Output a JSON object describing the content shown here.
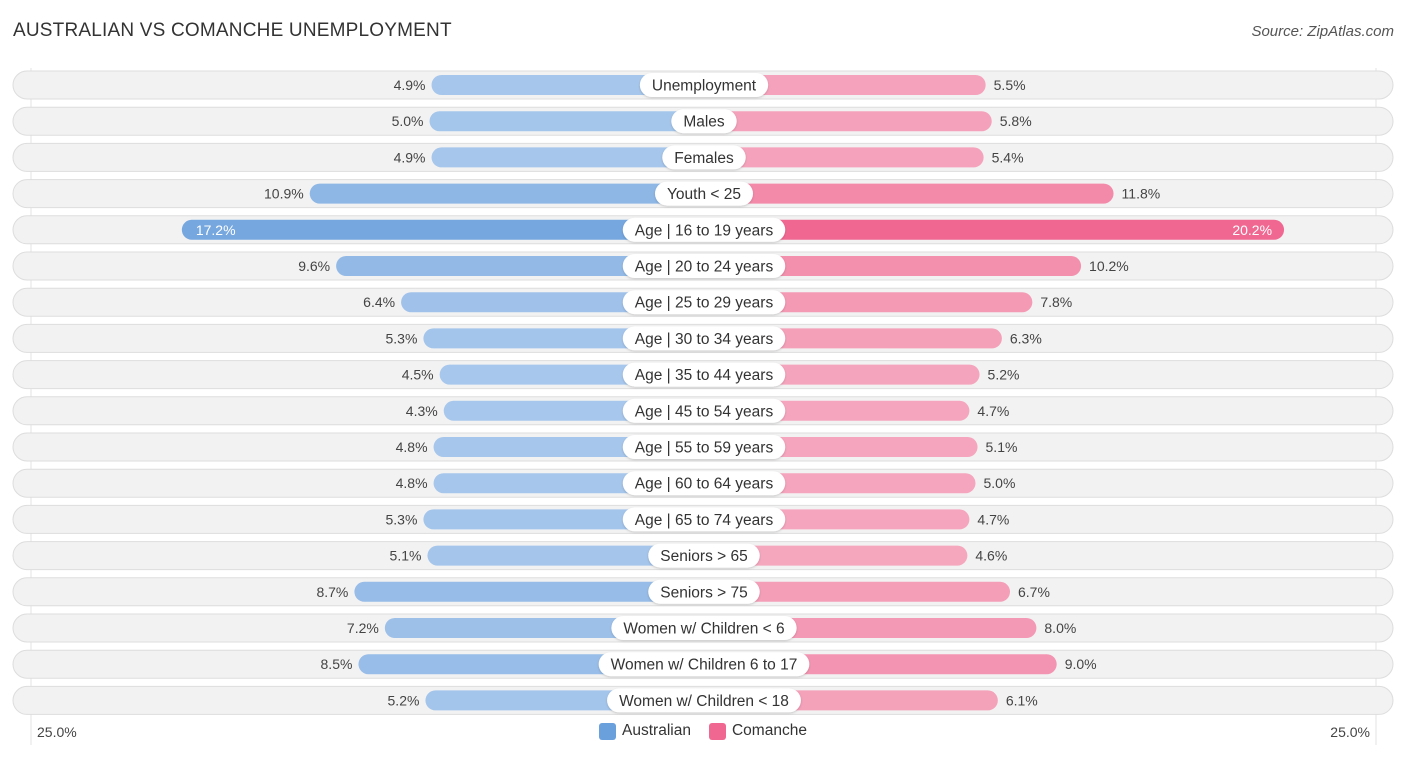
{
  "title": "AUSTRALIAN VS COMANCHE UNEMPLOYMENT",
  "source": "Source: ZipAtlas.com",
  "colors": {
    "australian": "#6aa0dc",
    "australian_light": "#a9c8ec",
    "comanche": "#f06892",
    "comanche_light": "#f5a9c0"
  },
  "legend": [
    {
      "name": "Australian",
      "color": "#6aa0dc"
    },
    {
      "name": "Comanche",
      "color": "#f06892"
    }
  ],
  "axis": {
    "left_label": "25.0%",
    "right_label": "25.0%"
  },
  "chart_data": {
    "type": "bar",
    "orientation": "horizontal-diverging",
    "title": "AUSTRALIAN VS COMANCHE UNEMPLOYMENT",
    "xlim": [
      0,
      25
    ],
    "unit": "%",
    "categories": [
      "Unemployment",
      "Males",
      "Females",
      "Youth < 25",
      "Age | 16 to 19 years",
      "Age | 20 to 24 years",
      "Age | 25 to 29 years",
      "Age | 30 to 34 years",
      "Age | 35 to 44 years",
      "Age | 45 to 54 years",
      "Age | 55 to 59 years",
      "Age | 60 to 64 years",
      "Age | 65 to 74 years",
      "Seniors > 65",
      "Seniors > 75",
      "Women w/ Children < 6",
      "Women w/ Children 6 to 17",
      "Women w/ Children < 18"
    ],
    "series": [
      {
        "name": "Australian",
        "side": "left",
        "values": [
          4.9,
          5.0,
          4.9,
          10.9,
          17.2,
          9.6,
          6.4,
          5.3,
          4.5,
          4.3,
          4.8,
          4.8,
          5.3,
          5.1,
          8.7,
          7.2,
          8.5,
          5.2
        ]
      },
      {
        "name": "Comanche",
        "side": "right",
        "values": [
          5.5,
          5.8,
          5.4,
          11.8,
          20.2,
          10.2,
          7.8,
          6.3,
          5.2,
          4.7,
          5.1,
          5.0,
          4.7,
          4.6,
          6.7,
          8.0,
          9.0,
          6.1
        ]
      }
    ],
    "legend_position": "bottom-center",
    "grid": false
  }
}
